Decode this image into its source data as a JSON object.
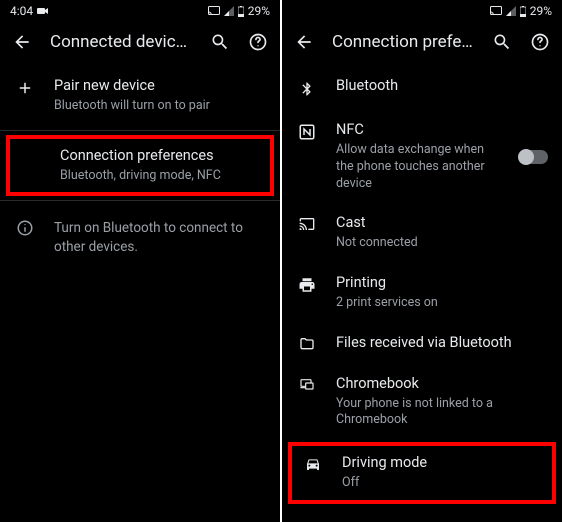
{
  "status": {
    "time": "4:04",
    "battery": "29%"
  },
  "left": {
    "title": "Connected devices",
    "pair": {
      "title": "Pair new device",
      "sub": "Bluetooth will turn on to pair"
    },
    "connPref": {
      "title": "Connection preferences",
      "sub": "Bluetooth, driving mode, NFC"
    },
    "info": "Turn on Bluetooth to connect to other devices."
  },
  "right": {
    "title": "Connection preferen...",
    "bt": {
      "title": "Bluetooth"
    },
    "nfc": {
      "title": "NFC",
      "sub": "Allow data exchange when the phone touches another device"
    },
    "cast": {
      "title": "Cast",
      "sub": "Not connected"
    },
    "printing": {
      "title": "Printing",
      "sub": "2 print services on"
    },
    "files": {
      "title": "Files received via Bluetooth"
    },
    "chromebook": {
      "title": "Chromebook",
      "sub": "Your phone is not linked to a Chromebook"
    },
    "driving": {
      "title": "Driving mode",
      "sub": "Off"
    }
  }
}
